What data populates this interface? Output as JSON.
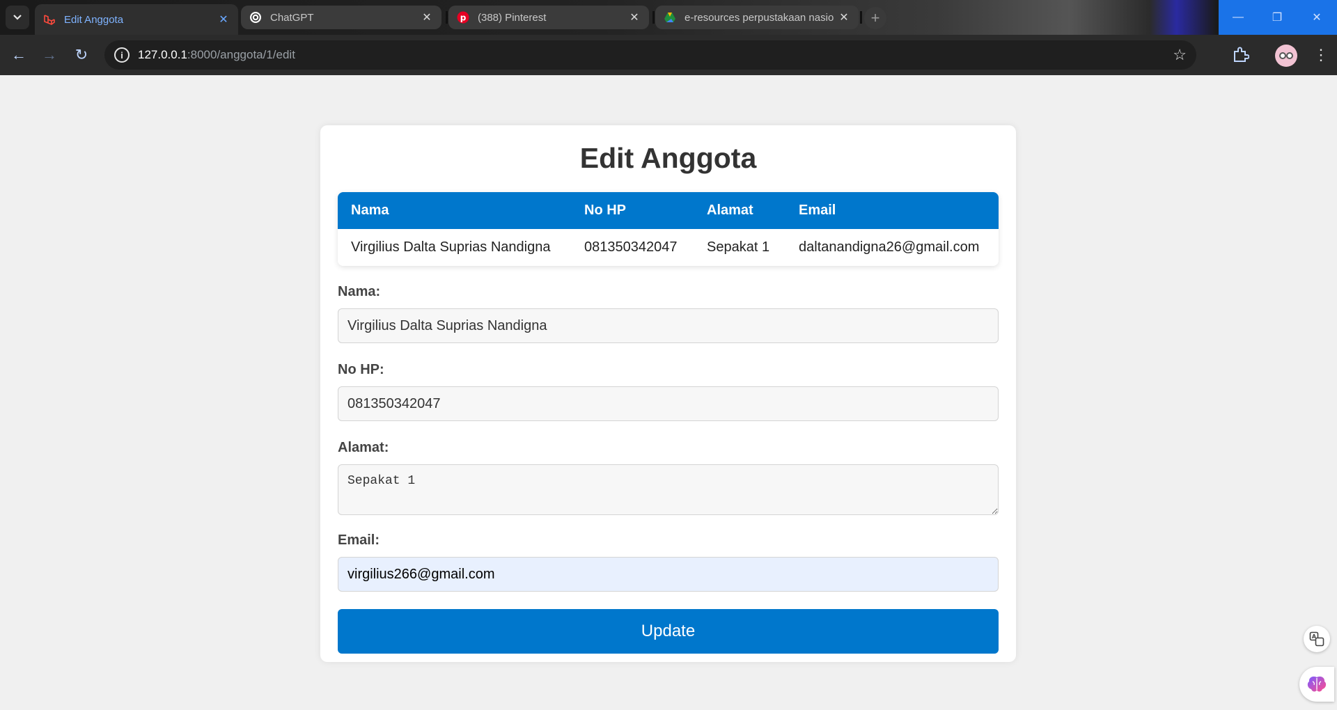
{
  "browser": {
    "tabs": [
      {
        "title": "Edit Anggota",
        "active": true,
        "icon": "laravel-icon"
      },
      {
        "title": "ChatGPT",
        "active": false,
        "icon": "chatgpt-icon"
      },
      {
        "title": "(388) Pinterest",
        "active": false,
        "icon": "pinterest-icon"
      },
      {
        "title": "e-resources perpustakaan nasio",
        "active": false,
        "icon": "google-drive-icon"
      }
    ],
    "url_host": "127.0.0.1",
    "url_rest": ":8000/anggota/1/edit"
  },
  "page": {
    "title": "Edit Anggota",
    "table": {
      "headers": [
        "Nama",
        "No HP",
        "Alamat",
        "Email"
      ],
      "rows": [
        [
          "Virgilius Dalta Suprias Nandigna",
          "081350342047",
          "Sepakat 1",
          "daltanandigna26@gmail.com"
        ]
      ]
    },
    "form": {
      "nama_label": "Nama:",
      "nama_value": "Virgilius Dalta Suprias Nandigna",
      "nohp_label": "No HP:",
      "nohp_value": "081350342047",
      "alamat_label": "Alamat:",
      "alamat_value": "Sepakat 1",
      "email_label": "Email:",
      "email_value": "virgilius266@gmail.com",
      "submit_label": "Update"
    }
  },
  "colors": {
    "accent": "#0077cc",
    "background": "#f0f0f0",
    "autofill": "#e8f0fe"
  }
}
